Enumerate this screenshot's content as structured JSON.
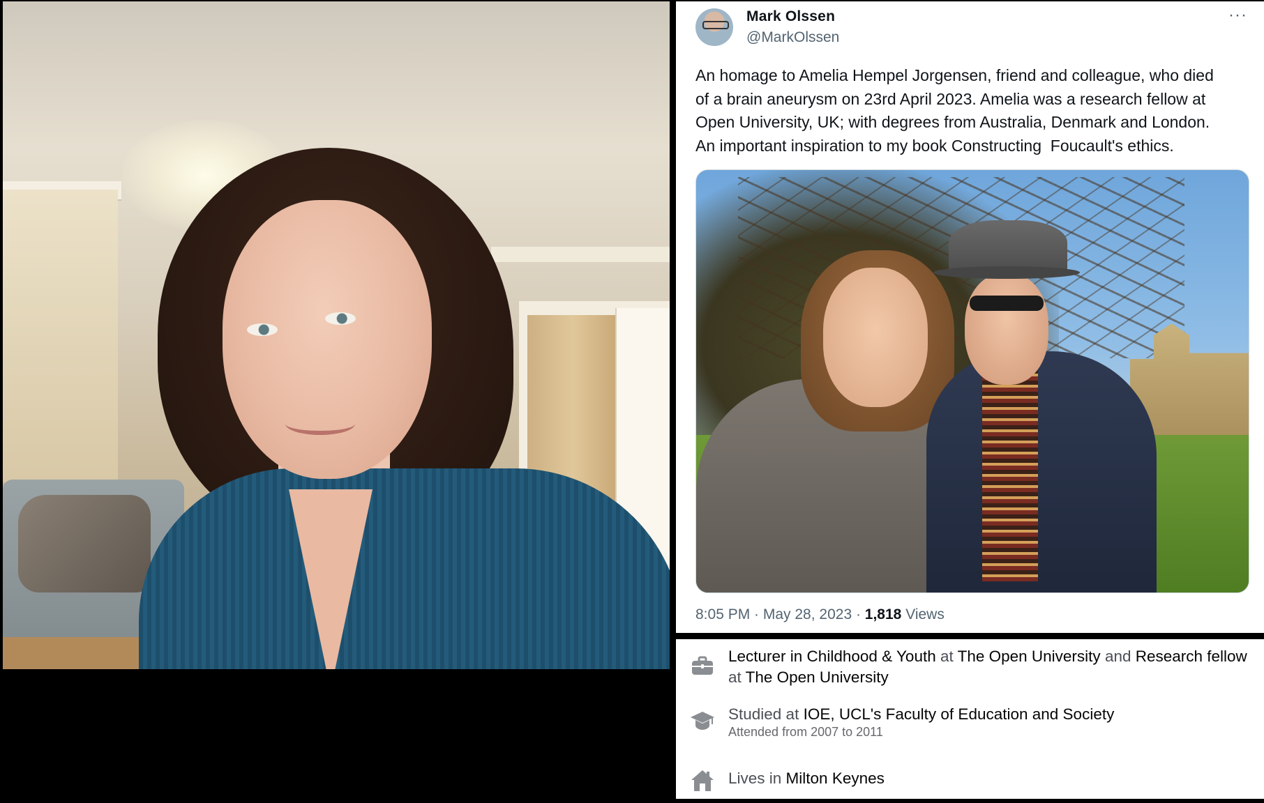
{
  "tweet": {
    "author_name": "Mark Olssen",
    "author_handle": "@MarkOlssen",
    "more_icon": "more-horizontal-icon",
    "text": "An homage to Amelia Hempel Jorgensen, friend and colleague, who died\nof a brain aneurysm on 23rd April 2023. Amelia was a research fellow at\nOpen University, UK; with degrees from Australia, Denmark and London.\nAn important inspiration to my book Constructing  Foucault's ethics.",
    "timestamp": "8:05 PM · May 28, 2023 · ",
    "views_count": "1,818",
    "views_label": " Views"
  },
  "profile_info": {
    "work": {
      "icon": "briefcase-icon",
      "role": "Lecturer in Childhood & Youth",
      "at1": " at ",
      "org1": "The Open University",
      "and": " and ",
      "role2": "Research fellow",
      "at2": "at ",
      "org2": "The Open University"
    },
    "education": {
      "icon": "graduation-cap-icon",
      "prefix": "Studied at ",
      "school": "IOE, UCL's Faculty of Education and Society",
      "attended": "Attended from 2007 to 2011"
    },
    "home": {
      "icon": "home-icon",
      "prefix": "Lives in ",
      "city": "Milton Keynes"
    }
  },
  "colors": {
    "tweet_text": "#0f1419",
    "tweet_secondary": "#536471",
    "info_text": "#050505",
    "info_secondary": "#65676b",
    "background": "#000000"
  }
}
